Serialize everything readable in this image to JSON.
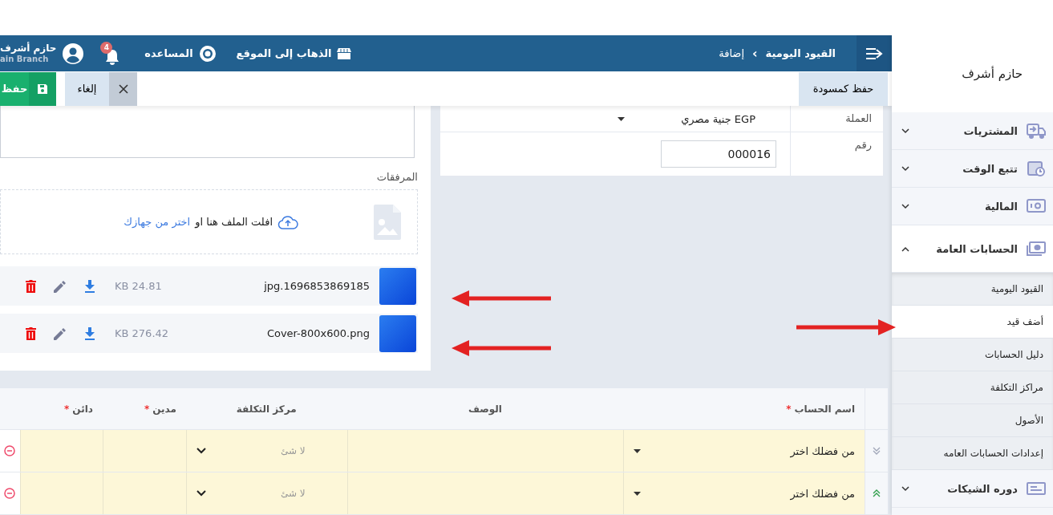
{
  "topbar": {
    "breadcrumb": [
      {
        "label": "القيود اليومية",
        "selected": false
      },
      {
        "label": "إضافة",
        "selected": true
      }
    ],
    "separator": "›",
    "links": [
      {
        "label": "الذهاب إلى الموقع",
        "kind": "store"
      },
      {
        "label": "المساعده",
        "kind": "help"
      }
    ],
    "notifications": {
      "badge": "4"
    },
    "user": {
      "name": "حازم أشرف",
      "branch": "ain Branch"
    }
  },
  "actions": {
    "draft": "حفظ كمسودة",
    "cancel": "إلغاء",
    "save": "حفظ"
  },
  "form": {
    "fields": [
      {
        "label": "العملة",
        "value": "EGP جنية مصري",
        "kind": "select"
      },
      {
        "label": "رقم",
        "value": "000016",
        "kind": "input"
      }
    ]
  },
  "attachments": {
    "label": "المرفقات",
    "drop_text": "افلت الملف هنا او",
    "drop_link": "اختر من جهازك",
    "files": [
      {
        "name": "jpg.1696853869185",
        "size": "KB 24.81"
      },
      {
        "name": "Cover-800x600.png",
        "size": "KB 276.42"
      }
    ]
  },
  "table": {
    "columns": [
      {
        "label": "اسم الحساب",
        "required": true
      },
      {
        "label": "الوصف",
        "required": false
      },
      {
        "label": "مركز التكلفة",
        "required": false
      },
      {
        "label": "مدين",
        "required": true
      },
      {
        "label": "دائن",
        "required": true
      }
    ],
    "required_mark": "*",
    "rows": [
      {
        "kind": "down",
        "account": "من فضلك اختر",
        "cost_center": "لا شئ"
      },
      {
        "kind": "up",
        "account": "من فضلك اختر",
        "cost_center": "لا شئ"
      }
    ]
  },
  "sidebar": {
    "user": "حازم أشرف",
    "items": [
      {
        "label": "المشتريات",
        "kind": "truck",
        "expanded": false
      },
      {
        "label": "تتبع الوقت",
        "kind": "calendar",
        "expanded": false
      },
      {
        "label": "المالية",
        "kind": "safe",
        "expanded": false
      },
      {
        "label": "الحسابات العامة",
        "kind": "money",
        "expanded": true,
        "children": [
          {
            "label": "القيود اليومية",
            "selected": false
          },
          {
            "label": "أضف قيد",
            "selected": true
          },
          {
            "label": "دليل الحسابات",
            "selected": false
          },
          {
            "label": "مراكز التكلفة",
            "selected": false
          },
          {
            "label": "الأصول",
            "selected": false
          },
          {
            "label": "إعدادات الحسابات العامه",
            "selected": false
          }
        ]
      },
      {
        "label": "دوره الشيكات",
        "kind": "cheque",
        "expanded": false
      }
    ]
  },
  "annotations": [
    {
      "kind": "left"
    },
    {
      "kind": "left"
    },
    {
      "kind": "right"
    }
  ]
}
